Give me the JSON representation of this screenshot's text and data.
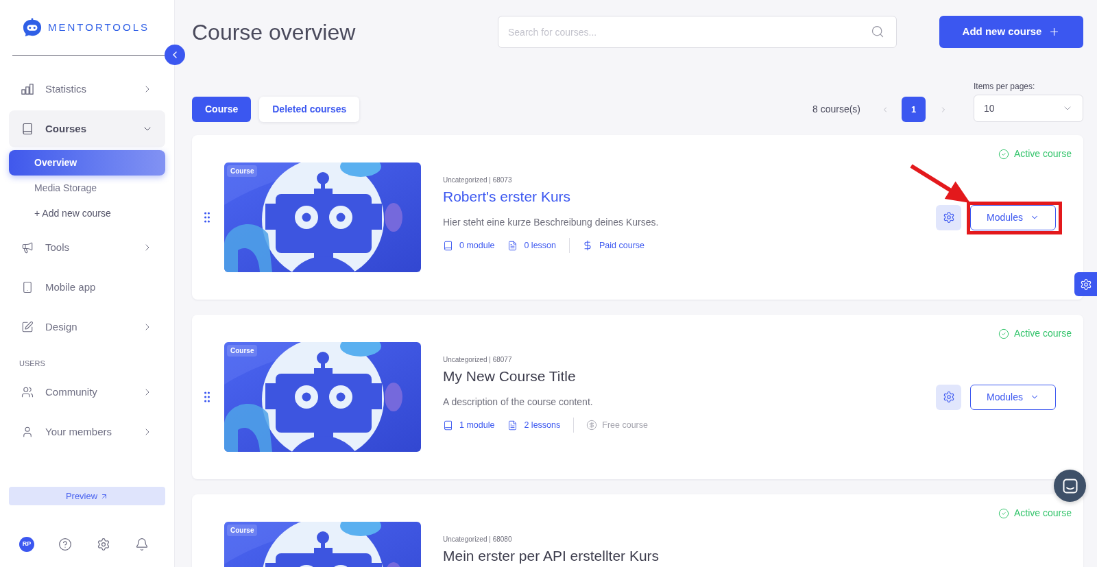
{
  "sidebar": {
    "logo": "MENTORTOOLS",
    "nav": [
      {
        "kind": "group",
        "label": "Statistics",
        "expanded": false
      },
      {
        "kind": "group",
        "label": "Courses",
        "expanded": true,
        "children": [
          {
            "kind": "page",
            "label": "Overview",
            "selected": true
          },
          {
            "kind": "page",
            "label": "Media Storage",
            "selected": false
          },
          {
            "kind": "action",
            "label": "+ Add new course",
            "selected": false
          }
        ]
      },
      {
        "kind": "group",
        "label": "Tools",
        "expanded": false
      },
      {
        "kind": "link",
        "label": "Mobile app"
      },
      {
        "kind": "group",
        "label": "Design",
        "expanded": false
      },
      {
        "kind": "section",
        "label": "USERS"
      },
      {
        "kind": "group",
        "label": "Community",
        "expanded": false
      },
      {
        "kind": "group",
        "label": "Your members",
        "expanded": false
      }
    ],
    "preview_button": "Preview",
    "user": {
      "initials": "RP"
    }
  },
  "header": {
    "title": "Course overview",
    "search": {
      "placeholder": "Search for courses..."
    },
    "add_button": "Add new course"
  },
  "tabs": [
    {
      "label": "Course",
      "selected": true
    },
    {
      "label": "Deleted courses",
      "selected": false
    }
  ],
  "pagination": {
    "count": "8 course(s)",
    "pages": [
      {
        "label": "1",
        "selected": true
      }
    ],
    "items_per_page": {
      "label": "Items per pages:",
      "value": "10"
    }
  },
  "courses": [
    {
      "badge": "Course",
      "meta": "Uncategorized | 68073",
      "title": "Robert's erster Kurs",
      "highlighted": true,
      "description": "Hier steht eine kurze Beschreibung deines Kurses.",
      "stats": [
        "0 module",
        "0 lesson"
      ],
      "price": {
        "kind": "paid",
        "label": "Paid course"
      },
      "status": "Active course",
      "actions": {
        "modules": "Modules",
        "marked": true
      }
    },
    {
      "badge": "Course",
      "meta": "Uncategorized | 68077",
      "title": "My New Course Title",
      "highlighted": false,
      "description": "A description of the course content.",
      "stats": [
        "1 module",
        "2 lessons"
      ],
      "price": {
        "kind": "free",
        "label": "Free course"
      },
      "status": "Active course",
      "actions": {
        "modules": "Modules",
        "marked": false
      }
    },
    {
      "badge": "Course",
      "meta": "Uncategorized | 68080",
      "title": "Mein erster per API erstellter Kurs",
      "highlighted": false,
      "status": "Active course"
    }
  ]
}
